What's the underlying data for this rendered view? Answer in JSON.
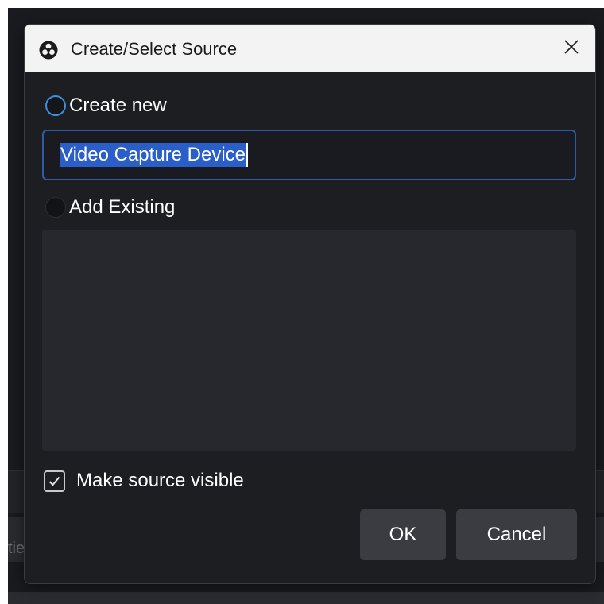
{
  "background": {
    "partial_text": "tie"
  },
  "dialog": {
    "title": "Create/Select Source",
    "close_icon": "close-icon",
    "app_icon": "obs-logo-icon",
    "create_new": {
      "label": "Create new",
      "selected": true
    },
    "source_name": {
      "value": "Video Capture Device",
      "text_selected": true
    },
    "add_existing": {
      "label": "Add Existing",
      "selected": false
    },
    "existing_sources": [],
    "make_visible": {
      "label": "Make source visible",
      "checked": true
    },
    "buttons": {
      "ok": "OK",
      "cancel": "Cancel"
    }
  },
  "colors": {
    "dialog_bg": "#1d1e22",
    "titlebar_bg": "#f3f3f3",
    "accent_blue": "#3d8fe0",
    "selection_blue": "#2a5ec9",
    "button_bg": "#3b3c42",
    "list_bg": "#27282e"
  }
}
